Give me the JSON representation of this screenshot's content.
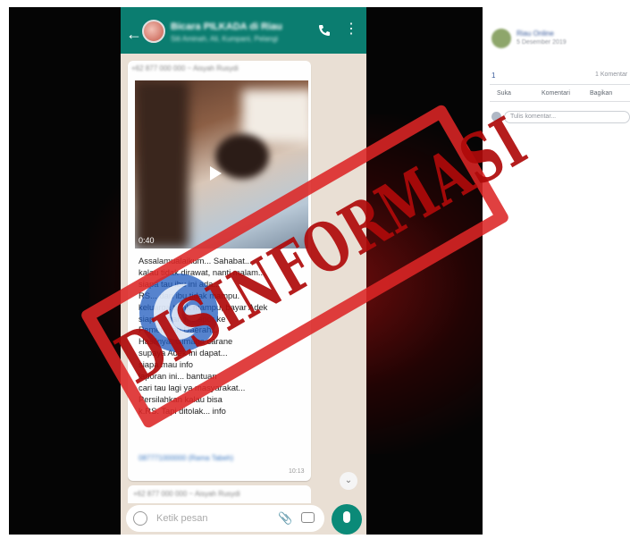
{
  "whatsapp": {
    "group_name": "Bicara PILKADA di Riau",
    "group_members": "Siti Aminah, Ali, Kumpani, Pelangi",
    "first_sender": "+62 877 000 000",
    "first_sender_name": "~ Aisyah Rusydi",
    "video_duration": "0:40",
    "message_text": "Assalamualaikum... Sahabat...\nkalau tidak dirawat, nanti malam...\nsiapa tau ibu ini ada...\nRS... dan ibu tidak mampu.\nkeluarga tidak mampu, bayar Adek\nsiapa... dan melapor ke\nPemerintah Daerah...\nHasilnya, Gimana carane\nsupaya Adek ini dapat...\nsiapa mau info\nlaporan ini... bantuan\ncari tau lagi ya masyarakat...\nPersilahkan kalau bisa\nk.RS. Tapi ditolak... info",
    "message_link": "087771000000 (Rama Tabeh)",
    "message_time": "10:13",
    "second_sender": "+62 877 000 000",
    "second_sender_name": "~ Aisyah Rusydi",
    "input_placeholder": "Ketik pesan",
    "header_color": "#0b7d70",
    "mic_color": "#0b8a78"
  },
  "facebook": {
    "poster_name": "Riau Online",
    "post_time": "5 Desember 2019",
    "like_count": "1",
    "comments_count": "1 Komentar",
    "actions": [
      "Suka",
      "Komentari",
      "Bagikan"
    ],
    "comment_placeholder": "Tulis komentar..."
  },
  "stamp": {
    "text": "DISINFORMASI",
    "color": "#dc2626"
  },
  "icons": [
    "back-arrow-icon",
    "phone-call-icon",
    "kebab-menu-icon",
    "play-icon",
    "emoji-icon",
    "attach-icon",
    "camera-icon",
    "mic-icon",
    "scroll-down-icon",
    "kominfo-logo"
  ]
}
